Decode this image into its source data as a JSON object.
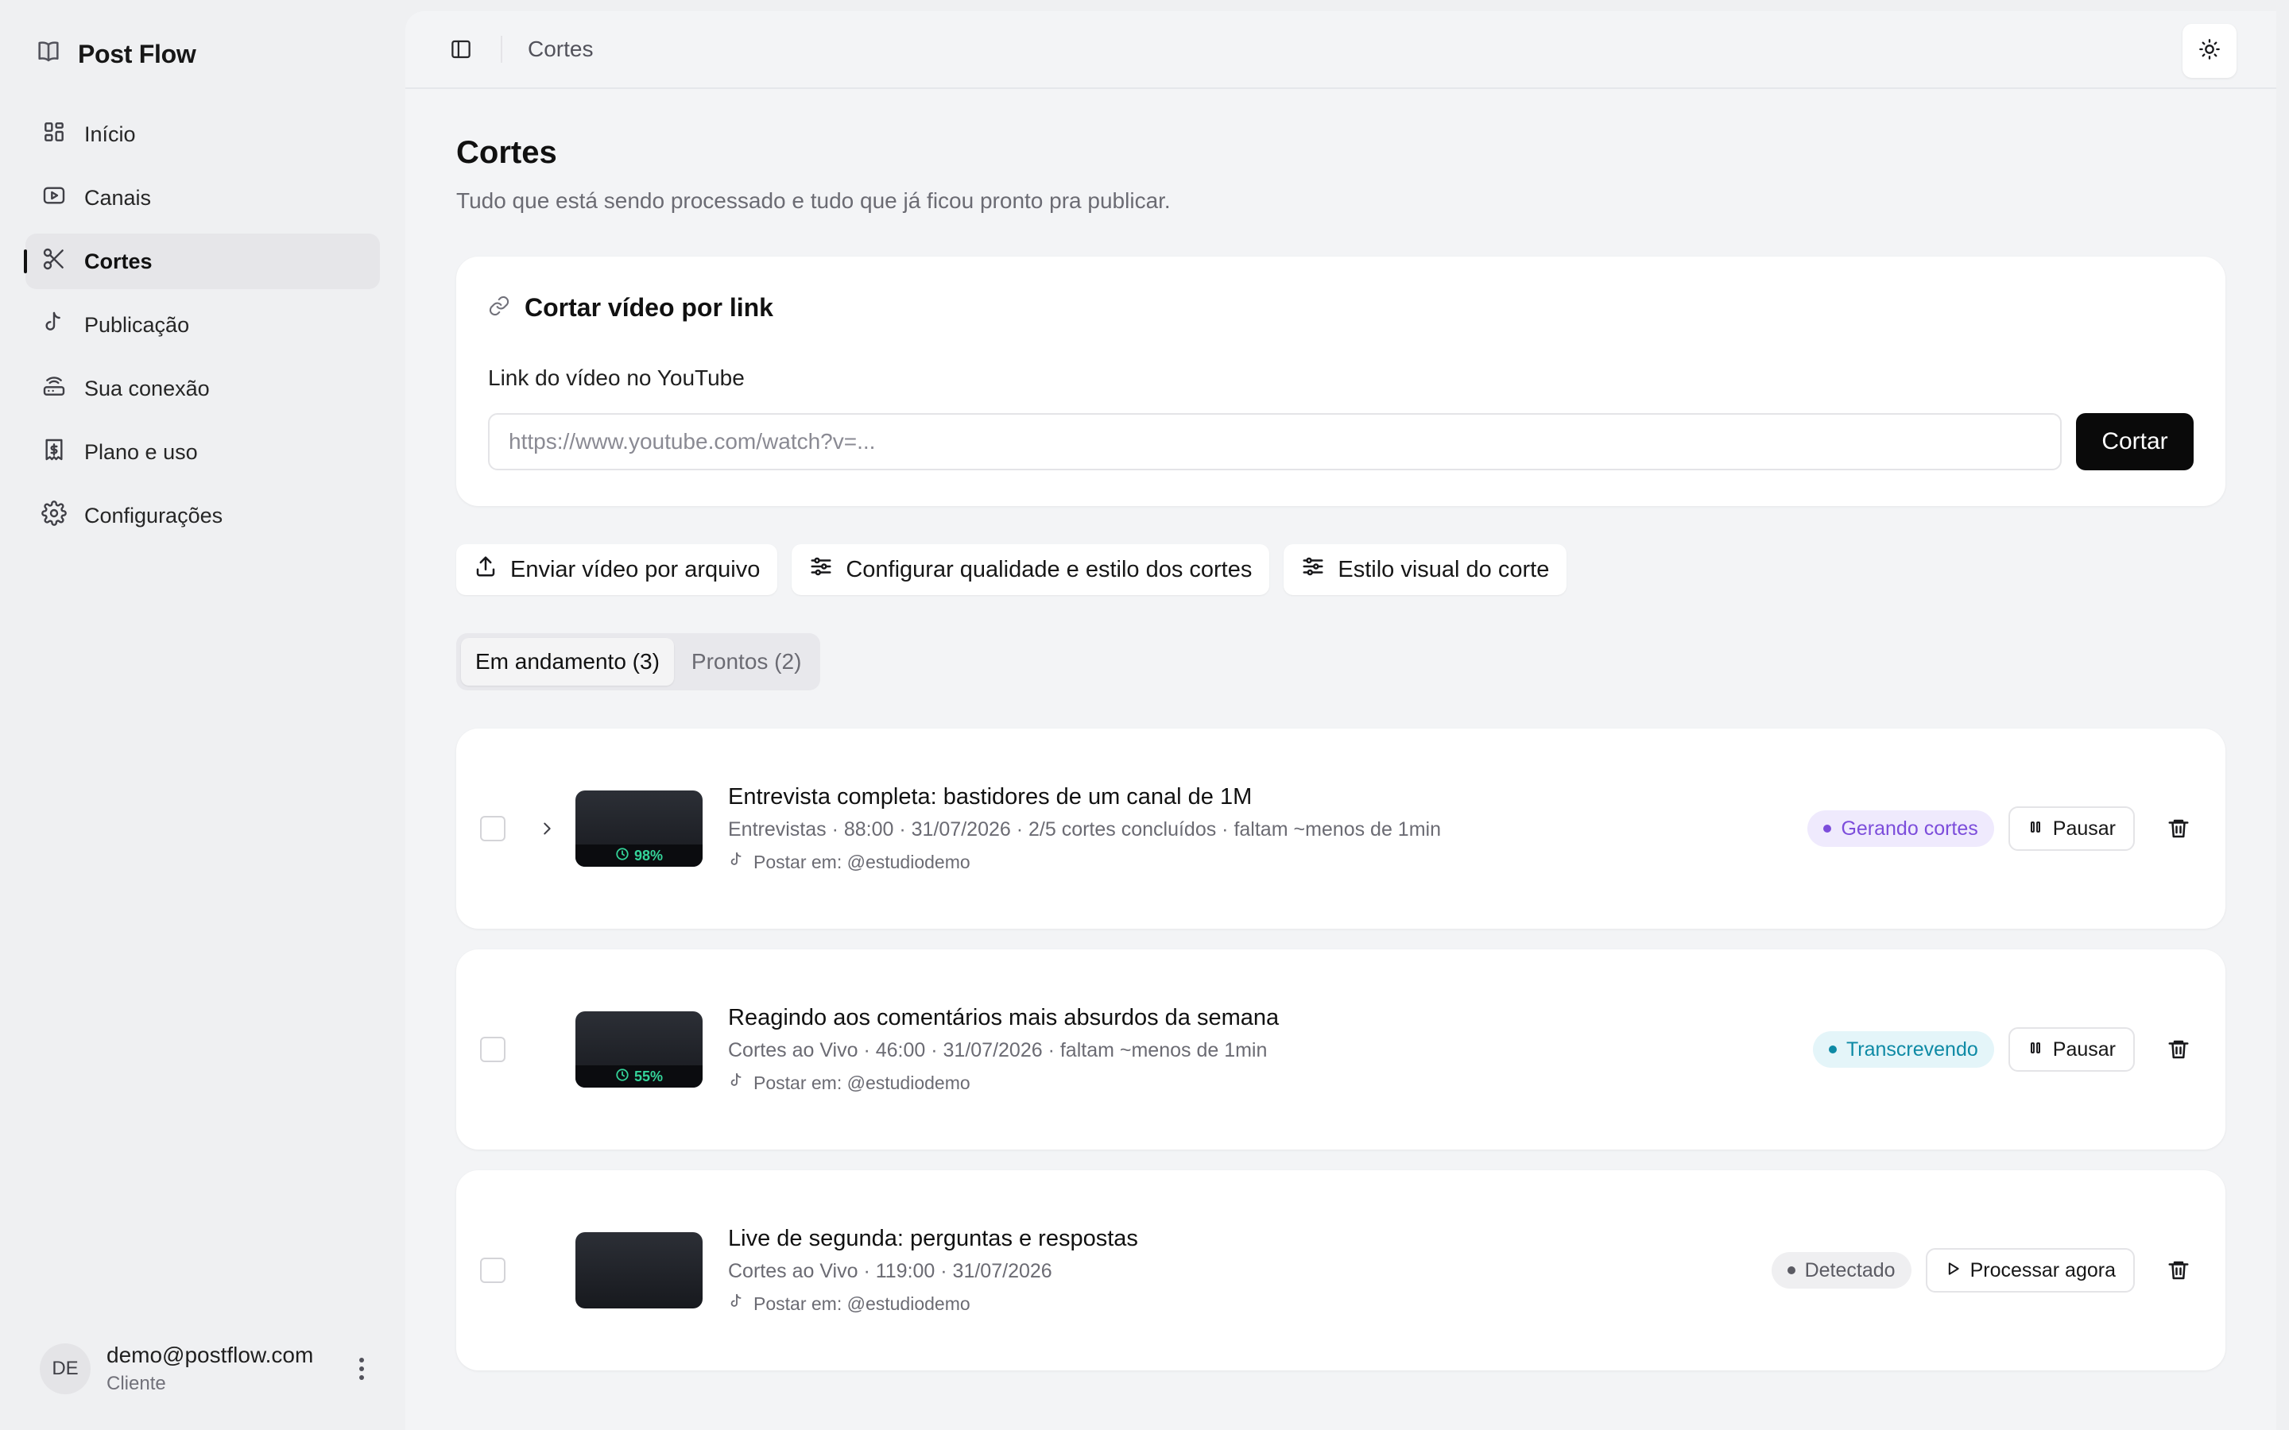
{
  "app": {
    "name": "Post Flow",
    "logo_icon": "book-open-icon"
  },
  "sidebar": {
    "items": [
      {
        "label": "Início",
        "icon": "dashboard-icon",
        "active": false
      },
      {
        "label": "Canais",
        "icon": "youtube-icon",
        "active": false
      },
      {
        "label": "Cortes",
        "icon": "scissors-icon",
        "active": true
      },
      {
        "label": "Publicação",
        "icon": "tiktok-icon",
        "active": false
      },
      {
        "label": "Sua conexão",
        "icon": "router-icon",
        "active": false
      },
      {
        "label": "Plano e uso",
        "icon": "receipt-icon",
        "active": false
      },
      {
        "label": "Configurações",
        "icon": "gear-icon",
        "active": false
      }
    ],
    "user": {
      "initials": "DE",
      "email": "demo@postflow.com",
      "role": "Cliente"
    }
  },
  "topbar": {
    "breadcrumb": "Cortes",
    "theme_icon": "sun-icon"
  },
  "page": {
    "title": "Cortes",
    "subtitle": "Tudo que está sendo processado e tudo que já ficou pronto pra publicar."
  },
  "link_card": {
    "title": "Cortar vídeo por link",
    "field_label": "Link do vídeo no YouTube",
    "placeholder": "https://www.youtube.com/watch?v=...",
    "value": "",
    "submit_label": "Cortar"
  },
  "actions": [
    {
      "label": "Enviar vídeo por arquivo",
      "icon": "upload-icon"
    },
    {
      "label": "Configurar qualidade e estilo dos cortes",
      "icon": "sliders-icon"
    },
    {
      "label": "Estilo visual do corte",
      "icon": "sliders-icon"
    }
  ],
  "tabs": [
    {
      "label": "Em andamento (3)",
      "active": true
    },
    {
      "label": "Prontos (2)",
      "active": false
    }
  ],
  "jobs": [
    {
      "title": "Entrevista completa: bastidores de um canal de 1M",
      "meta": "Entrevistas · 88:00 · 31/07/2026 · 2/5 cortes concluídos · faltam ~menos de 1min",
      "post_to": "Postar em: @estudiodemo",
      "progress": "98%",
      "expandable": true,
      "status": "Gerando cortes",
      "status_bg": "#efeafd",
      "status_color": "#7c4ddb",
      "action_label": "Pausar",
      "action_icon": "pause-icon"
    },
    {
      "title": "Reagindo aos comentários mais absurdos da semana",
      "meta": "Cortes ao Vivo · 46:00 · 31/07/2026 · faltam ~menos de 1min",
      "post_to": "Postar em: @estudiodemo",
      "progress": "55%",
      "expandable": false,
      "status": "Transcrevendo",
      "status_bg": "#e4f5f9",
      "status_color": "#0e8aa5",
      "action_label": "Pausar",
      "action_icon": "pause-icon"
    },
    {
      "title": "Live de segunda: perguntas e respostas",
      "meta": "Cortes ao Vivo · 119:00 · 31/07/2026",
      "post_to": "Postar em: @estudiodemo",
      "progress": null,
      "expandable": false,
      "status": "Detectado",
      "status_bg": "#efeff1",
      "status_color": "#5b5b63",
      "action_label": "Processar agora",
      "action_icon": "play-icon"
    }
  ]
}
